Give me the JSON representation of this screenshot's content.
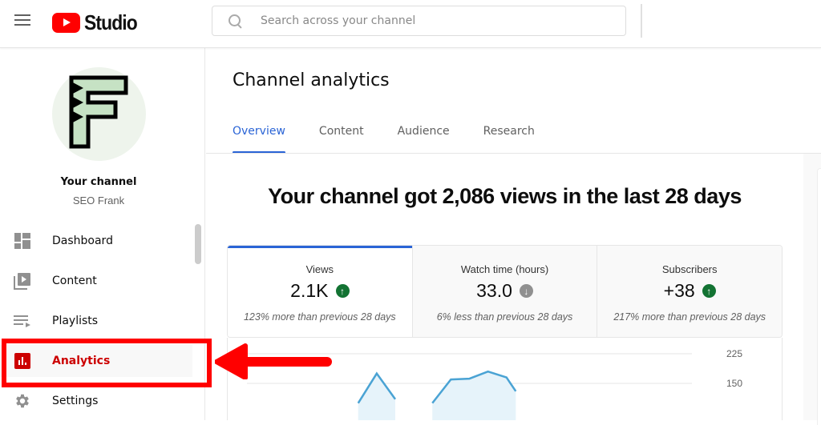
{
  "app": {
    "title": "Studio",
    "search_placeholder": "Search across your channel"
  },
  "sidebar": {
    "channel_title": "Your channel",
    "channel_name": "SEO Frank",
    "items": [
      {
        "label": "Dashboard",
        "icon": "dashboard-icon"
      },
      {
        "label": "Content",
        "icon": "content-icon"
      },
      {
        "label": "Playlists",
        "icon": "playlists-icon"
      },
      {
        "label": "Analytics",
        "icon": "analytics-icon",
        "active": true
      },
      {
        "label": "Settings",
        "icon": "settings-icon"
      }
    ]
  },
  "main": {
    "page_title": "Channel analytics",
    "tabs": [
      {
        "label": "Overview",
        "active": true
      },
      {
        "label": "Content"
      },
      {
        "label": "Audience"
      },
      {
        "label": "Research"
      }
    ],
    "headline": "Your channel got 2,086 views in the last 28 days",
    "metrics": [
      {
        "label": "Views",
        "value": "2.1K",
        "trend": "up",
        "note": "123% more than previous 28 days"
      },
      {
        "label": "Watch time (hours)",
        "value": "33.0",
        "trend": "down",
        "note": "6% less than previous 28 days"
      },
      {
        "label": "Subscribers",
        "value": "+38",
        "trend": "up",
        "note": "217% more than previous 28 days"
      }
    ],
    "chart": {
      "y_ticks": [
        "225",
        "150"
      ],
      "y_tick_values": [
        225,
        150
      ],
      "series_points": [
        {
          "x": 6,
          "y": 100
        },
        {
          "x": 7,
          "y": 175
        },
        {
          "x": 8,
          "y": 110
        },
        {
          "x": 10,
          "y": 100
        },
        {
          "x": 11,
          "y": 160
        },
        {
          "x": 12,
          "y": 162
        },
        {
          "x": 13,
          "y": 180
        },
        {
          "x": 14,
          "y": 165
        },
        {
          "x": 14.5,
          "y": 130
        }
      ],
      "x_range": [
        0,
        24
      ],
      "y_range": [
        100,
        250
      ]
    }
  },
  "colors": {
    "brand_red": "#ff0000",
    "active_nav": "#cc0000",
    "tab_accent": "#2a64d6",
    "trend_up": "#137333",
    "trend_down": "#909090",
    "chart_line": "#4aa3d4",
    "chart_fill": "#e6f3fa",
    "annotation_red": "#ff0000"
  },
  "annotation": {
    "highlight": "analytics-nav-highlight",
    "arrow": "left-pointing-arrow"
  }
}
